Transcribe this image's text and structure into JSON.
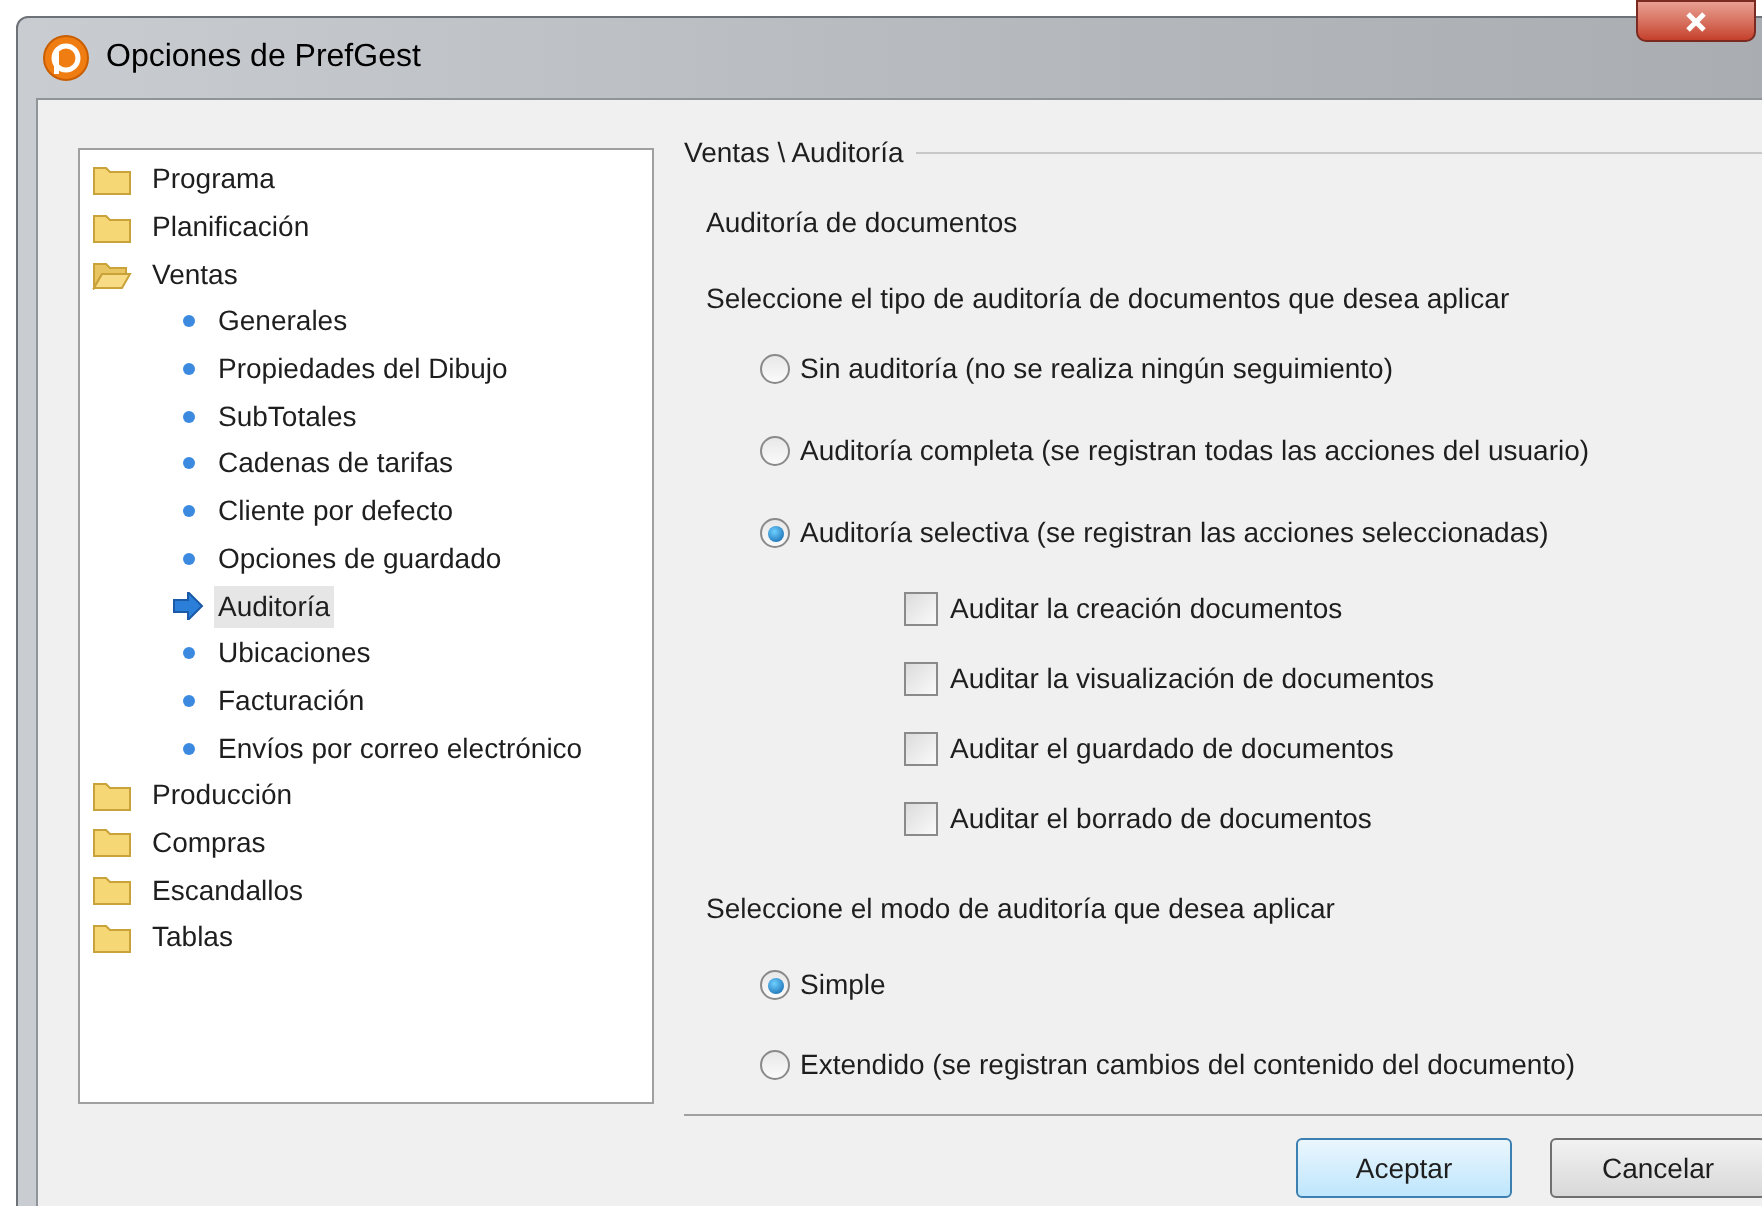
{
  "window": {
    "title": "Opciones de PrefGest"
  },
  "tree": [
    {
      "label": "Programa",
      "expanded": false,
      "selected": false
    },
    {
      "label": "Planificación",
      "expanded": false,
      "selected": false
    },
    {
      "label": "Ventas",
      "expanded": true,
      "selected": false,
      "children": [
        {
          "label": "Generales",
          "selected": false
        },
        {
          "label": "Propiedades del Dibujo",
          "selected": false
        },
        {
          "label": "SubTotales",
          "selected": false
        },
        {
          "label": "Cadenas de tarifas",
          "selected": false
        },
        {
          "label": "Cliente por defecto",
          "selected": false
        },
        {
          "label": "Opciones de guardado",
          "selected": false
        },
        {
          "label": "Auditoría",
          "selected": true
        },
        {
          "label": "Ubicaciones",
          "selected": false
        },
        {
          "label": "Facturación",
          "selected": false
        },
        {
          "label": "Envíos por correo electrónico",
          "selected": false
        }
      ]
    },
    {
      "label": "Producción",
      "expanded": false,
      "selected": false
    },
    {
      "label": "Compras",
      "expanded": false,
      "selected": false
    },
    {
      "label": "Escandallos",
      "expanded": false,
      "selected": false
    },
    {
      "label": "Tablas",
      "expanded": false,
      "selected": false
    }
  ],
  "panel": {
    "breadcrumb": "Ventas \\ Auditoría",
    "heading": "Auditoría de documentos",
    "type_prompt": "Seleccione el tipo de auditoría de documentos que desea aplicar",
    "type_options": [
      {
        "label": "Sin auditoría (no se realiza ningún seguimiento)",
        "selected": false
      },
      {
        "label": "Auditoría completa (se registran todas las acciones del usuario)",
        "selected": false
      },
      {
        "label": "Auditoría selectiva (se registran las acciones seleccionadas)",
        "selected": true
      }
    ],
    "actions": [
      {
        "label": "Auditar la creación documentos",
        "checked": false
      },
      {
        "label": "Auditar la visualización de documentos",
        "checked": false
      },
      {
        "label": "Auditar el guardado de documentos",
        "checked": false
      },
      {
        "label": "Auditar el borrado de documentos",
        "checked": false
      }
    ],
    "mode_prompt": "Seleccione el modo de auditoría que desea aplicar",
    "mode_options": [
      {
        "label": "Simple",
        "selected": true
      },
      {
        "label": "Extendido (se registran cambios del contenido del documento)",
        "selected": false
      }
    ]
  },
  "buttons": [
    {
      "label": "Aceptar",
      "default": true
    },
    {
      "label": "Cancelar",
      "default": false
    }
  ]
}
